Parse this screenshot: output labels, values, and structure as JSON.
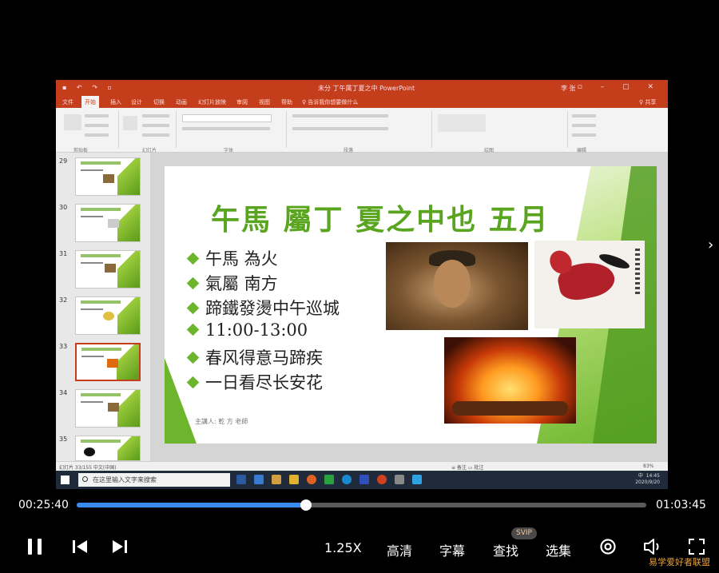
{
  "window": {
    "title": "未分 丁午属丁夏之中 PowerPoint",
    "user": "李 张 ",
    "tabs": [
      "文件",
      "开始",
      "插入",
      "设计",
      "切换",
      "动画",
      "幻灯片放映",
      "审阅",
      "视图",
      "帮助",
      "♀ 告诉我你想要做什么"
    ],
    "active_tab": "开始",
    "share": "♀ 共享",
    "ribbon_groups": [
      "剪贴板",
      "幻灯片",
      "字体",
      "段落",
      "绘图",
      "编辑"
    ]
  },
  "thumbnails": [
    {
      "num": "29"
    },
    {
      "num": "30"
    },
    {
      "num": "31"
    },
    {
      "num": "32"
    },
    {
      "num": "33",
      "selected": true
    },
    {
      "num": "34"
    },
    {
      "num": "35"
    }
  ],
  "slide": {
    "title": "午馬 屬丁 夏之中也 五月",
    "bullets": [
      "午馬 為火",
      "氣屬 南方",
      "蹄鐵發燙中午巡城",
      "11:00-13:00",
      "春风得意马蹄疾",
      "一日看尽长安花"
    ],
    "footnote": "主講人: 乾 方 老師"
  },
  "statusbar": {
    "left": "幻灯片 33/155   中文(中国)",
    "right": "≡ 备注   ▭ 批注",
    "zoom": "83%"
  },
  "taskbar": {
    "search_placeholder": "在这里输入文字来搜索",
    "time": "14:45",
    "date": "2020/9/20",
    "lang": "中"
  },
  "player": {
    "current_time": "00:25:40",
    "total_time": "01:03:45",
    "progress": 0.403,
    "speed": "1.25X",
    "quality": "高清",
    "subtitle": "字幕",
    "find": "查找",
    "svip": "SVIP",
    "episodes": "选集",
    "watermark": "易学爱好者联盟"
  }
}
